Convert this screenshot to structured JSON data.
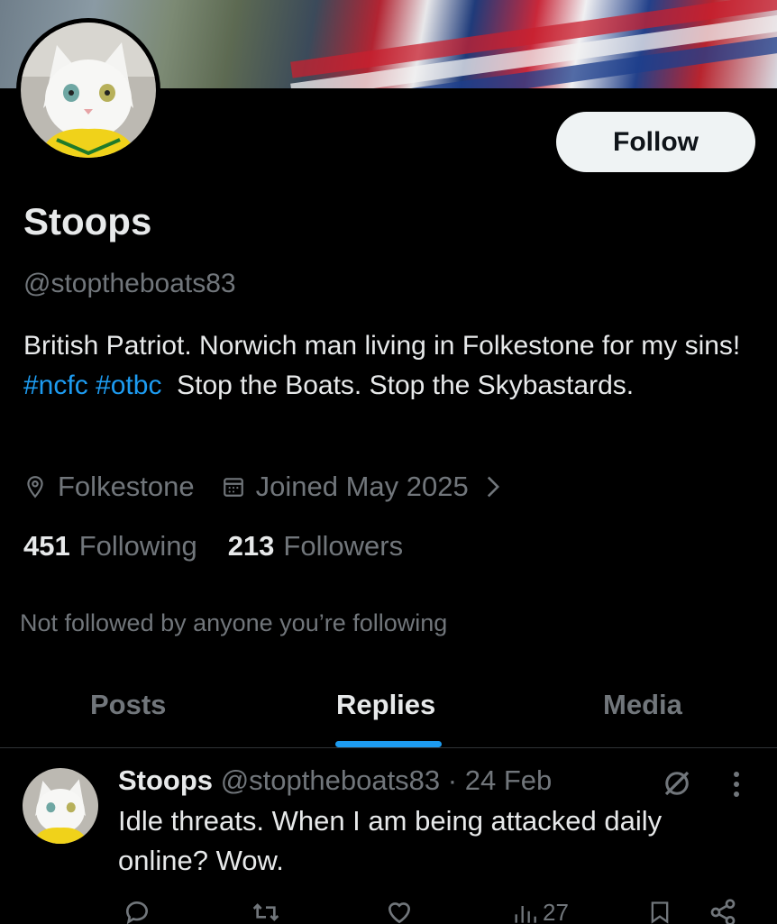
{
  "profile": {
    "name": "Stoops",
    "handle": "@stoptheboats83",
    "follow_label": "Follow",
    "bio_part1": "British Patriot. Norwich man living in Folkestone for my sins! ",
    "hashtag1": "#ncfc",
    "hashtag2": "#otbc",
    "bio_part2": "  Stop the Boats. Stop the Skybastards.",
    "location": "Folkestone",
    "joined": "Joined May 2025",
    "following_count": "451",
    "following_label": "Following",
    "followers_count": "213",
    "followers_label": "Followers",
    "mutuals_text": "Not followed by anyone you’re following"
  },
  "tabs": [
    {
      "label": "Posts",
      "active": false
    },
    {
      "label": "Replies",
      "active": true
    },
    {
      "label": "Media",
      "active": false
    }
  ],
  "post": {
    "name": "Stoops",
    "handle": "@stoptheboats83",
    "separator": "·",
    "date": "24 Feb",
    "text": "Idle threats. When I am being attacked daily online? Wow.",
    "views": "27"
  },
  "colors": {
    "background": "#000000",
    "text_primary": "#e7e9ea",
    "text_secondary": "#71767b",
    "accent": "#1d9bf0",
    "follow_button": "#eff3f4"
  },
  "icons": {
    "location": "map-pin-icon",
    "joined": "calendar-icon",
    "chevron": "chevron-right-icon",
    "grok": "grok-icon",
    "more": "more-vertical-icon",
    "reply": "reply-icon",
    "repost": "repost-icon",
    "like": "like-icon",
    "views": "views-icon",
    "bookmark": "bookmark-icon",
    "share": "share-icon"
  }
}
